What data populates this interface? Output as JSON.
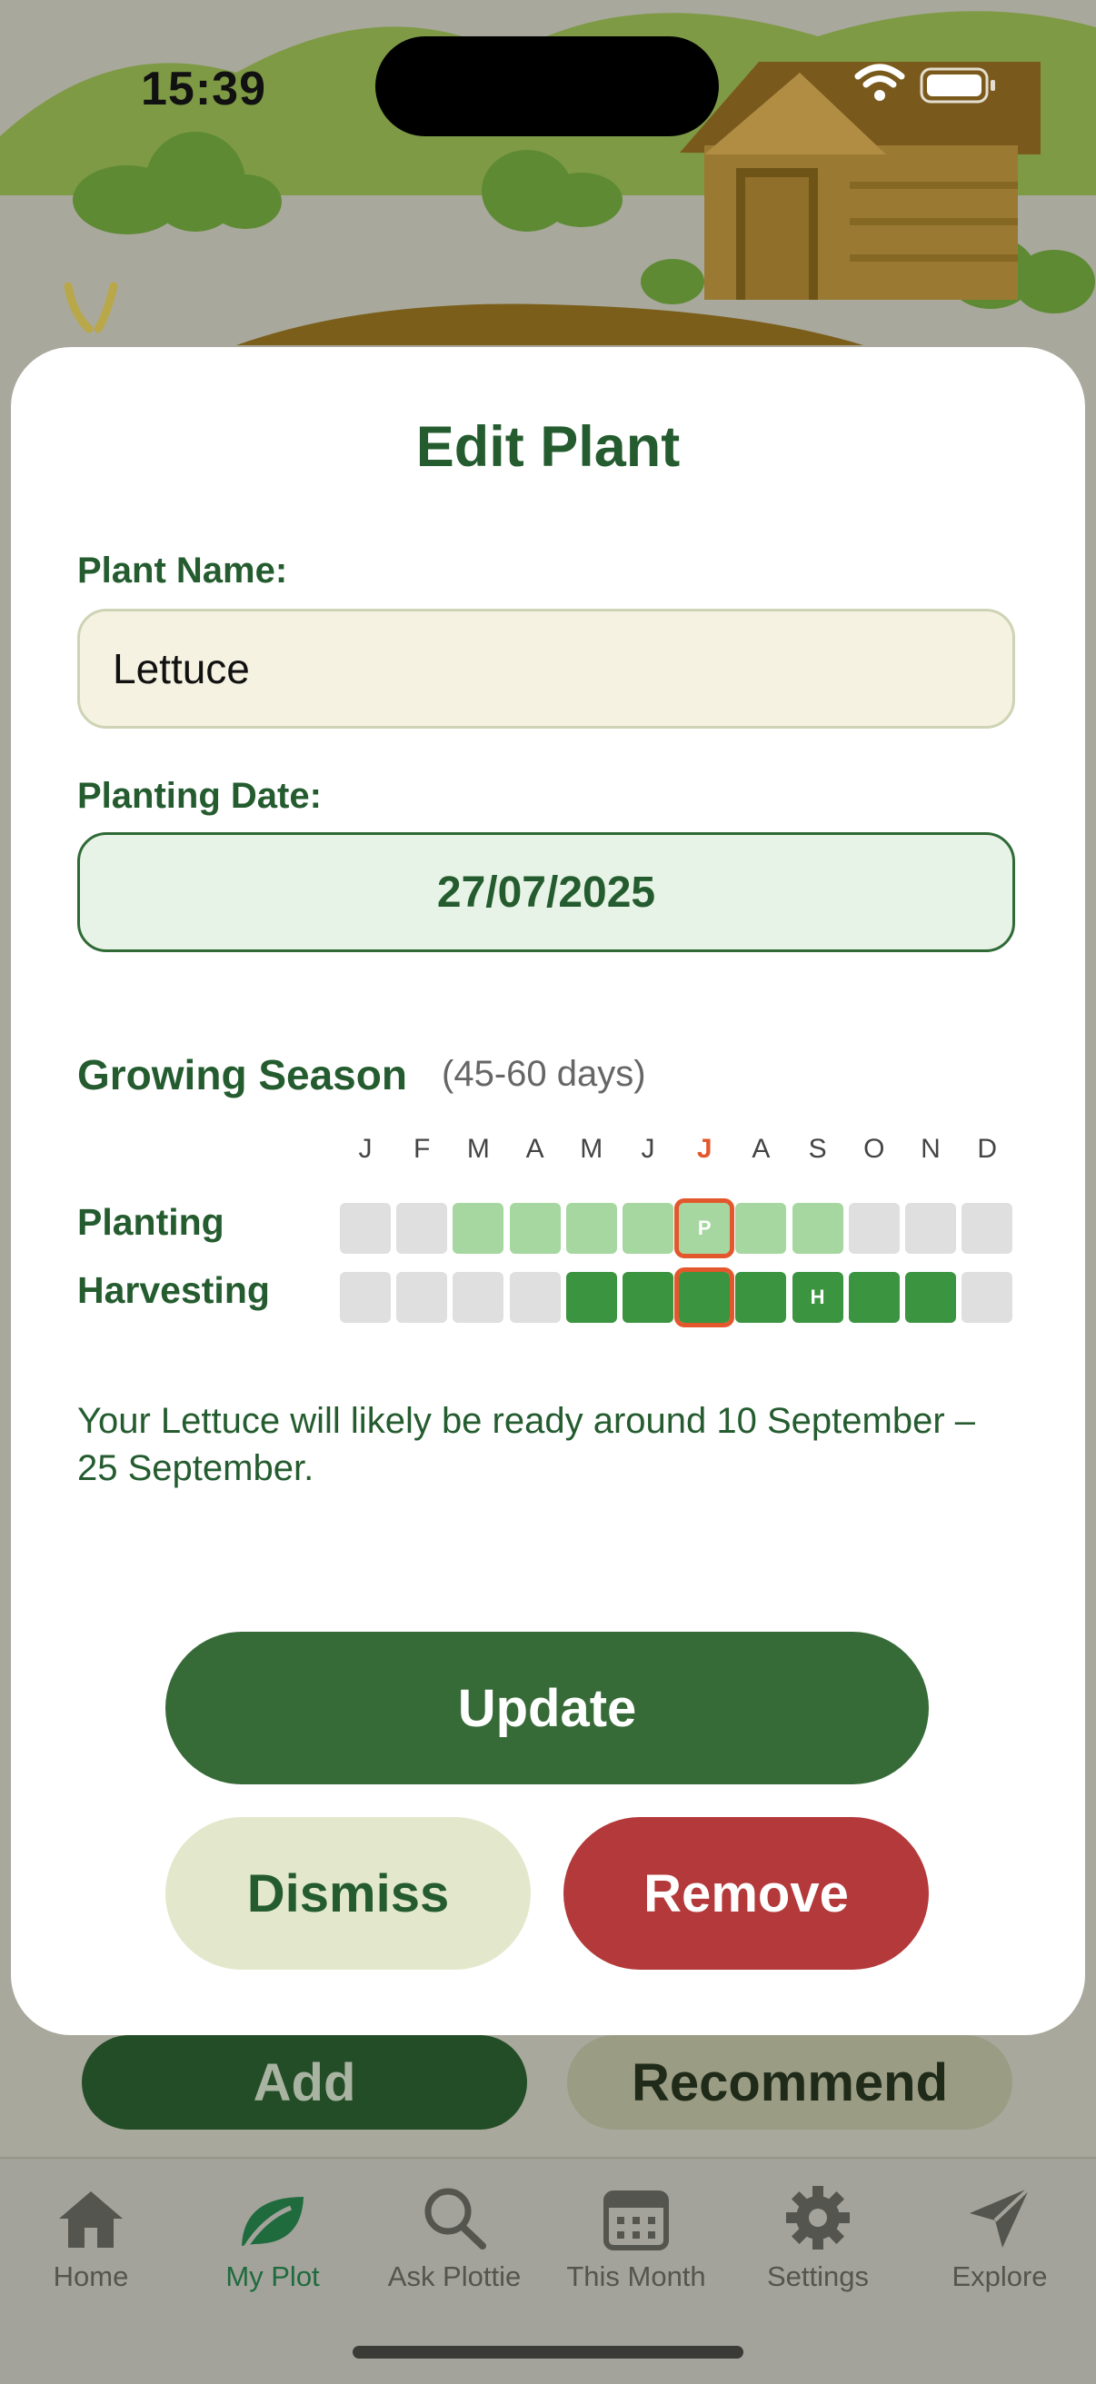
{
  "status": {
    "time": "15:39"
  },
  "sheet": {
    "title": "Edit Plant",
    "name_label": "Plant Name:",
    "name_value": "Lettuce",
    "date_label": "Planting Date:",
    "date_value": "27/07/2025",
    "season_title": "Growing Season",
    "season_duration": "(45-60 days)",
    "months": [
      "J",
      "F",
      "M",
      "A",
      "M",
      "J",
      "J",
      "A",
      "S",
      "O",
      "N",
      "D"
    ],
    "current_month_index": 6,
    "planting_label": "Planting",
    "harvesting_label": "Harvesting",
    "planting_levels": [
      0,
      0,
      1,
      1,
      1,
      1,
      1,
      1,
      1,
      0,
      0,
      0
    ],
    "harvesting_levels": [
      0,
      0,
      0,
      0,
      2,
      2,
      2,
      2,
      2,
      2,
      2,
      0
    ],
    "planting_marker": {
      "month_index": 6,
      "text": "P"
    },
    "harvest_marker": {
      "month_index": 8,
      "text": "H"
    },
    "message": "Your Lettuce will likely be ready around 10 September – 25 September.",
    "update_label": "Update",
    "dismiss_label": "Dismiss",
    "remove_label": "Remove"
  },
  "background_buttons": {
    "add_label": "Add",
    "recommend_label": "Recommend"
  },
  "tabs": [
    {
      "label": "Home",
      "icon": "house-icon",
      "active": false
    },
    {
      "label": "My Plot",
      "icon": "leaf-icon",
      "active": true
    },
    {
      "label": "Ask Plottie",
      "icon": "magnifier-icon",
      "active": false
    },
    {
      "label": "This Month",
      "icon": "calendar-icon",
      "active": false
    },
    {
      "label": "Settings",
      "icon": "gear-icon",
      "active": false
    },
    {
      "label": "Explore",
      "icon": "paper-plane-icon",
      "active": false
    }
  ],
  "colors": {
    "primary_green": "#366a37",
    "remove_red": "#b3393a",
    "current_month": "#e3572c"
  }
}
